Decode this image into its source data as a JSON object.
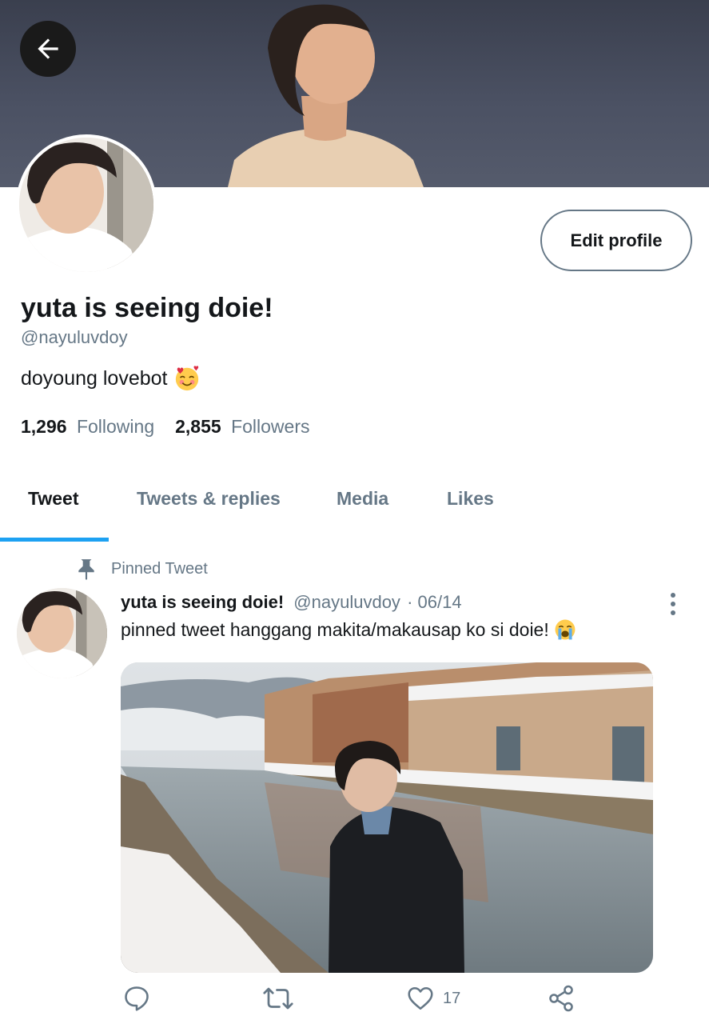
{
  "profile": {
    "display_name": "yuta is seeing doie!",
    "handle": "@nayuluvdoy",
    "bio": "doyoung lovebot",
    "edit_label": "Edit profile",
    "following_count": "1,296",
    "following_label": "Following",
    "followers_count": "2,855",
    "followers_label": "Followers"
  },
  "tabs": [
    {
      "label": "Tweet",
      "active": true
    },
    {
      "label": "Tweets & replies",
      "active": false
    },
    {
      "label": "Media",
      "active": false
    },
    {
      "label": "Likes",
      "active": false
    }
  ],
  "pinned": {
    "label": "Pinned Tweet",
    "name": "yuta is seeing doie!",
    "handle": "@nayuluvdoy",
    "date": "· 06/14",
    "text": "pinned tweet hanggang makita/makausap ko si doie!",
    "like_count": "17"
  },
  "colors": {
    "accent": "#1da1f2",
    "muted": "#657786",
    "text": "#14171a"
  }
}
